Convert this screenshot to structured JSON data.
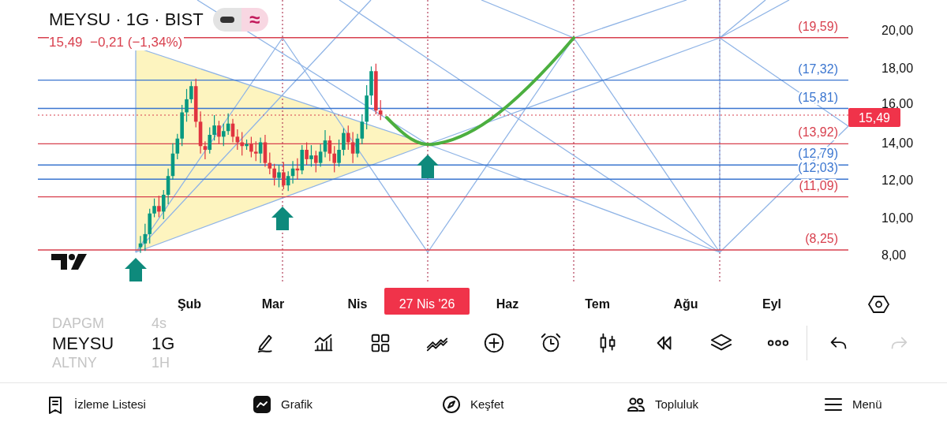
{
  "header": {
    "title": "MEYSU · 1G · BIST",
    "mode_glyph": "≈",
    "quote": "15,49  −0,21 (−1,34%)"
  },
  "levels": [
    {
      "label": "(19,59)",
      "color": "#d8404e"
    },
    {
      "label": "(17,32)",
      "color": "#3b76d0"
    },
    {
      "label": "(15,81)",
      "color": "#3b76d0"
    },
    {
      "label": "(13,92)",
      "color": "#d8404e"
    },
    {
      "label": "(12,79)",
      "color": "#3b76d0"
    },
    {
      "label": "(12,03)",
      "color": "#3b76d0"
    },
    {
      "label": "(11,09)",
      "color": "#d8404e"
    },
    {
      "label": "(8,25)",
      "color": "#d8404e"
    }
  ],
  "y_axis": [
    "20,00",
    "18,00",
    "16,00",
    "14,00",
    "12,00",
    "10,00",
    "8,00"
  ],
  "price_tag": "15,49",
  "x_axis": [
    {
      "label": "Şub",
      "selected": false
    },
    {
      "label": "Mar",
      "selected": false
    },
    {
      "label": "Nis",
      "selected": false
    },
    {
      "label": "27 Nis '26",
      "selected": true
    },
    {
      "label": "Haz",
      "selected": false
    },
    {
      "label": "Tem",
      "selected": false
    },
    {
      "label": "Ağu",
      "selected": false
    },
    {
      "label": "Eyl",
      "selected": false
    }
  ],
  "symbols": [
    {
      "name": "DAPGM",
      "interval": "4s",
      "selected": false
    },
    {
      "name": "MEYSU",
      "interval": "1G",
      "selected": true
    },
    {
      "name": "ALTNY",
      "interval": "1H",
      "selected": false
    }
  ],
  "toolbar": [
    {
      "kind": "pencil",
      "disabled": false
    },
    {
      "kind": "indicators",
      "disabled": false
    },
    {
      "kind": "grid",
      "disabled": false
    },
    {
      "kind": "wave",
      "disabled": false
    },
    {
      "kind": "plus",
      "disabled": false
    },
    {
      "kind": "alarm",
      "disabled": false
    },
    {
      "kind": "candle",
      "disabled": false
    },
    {
      "kind": "rewind",
      "disabled": false
    },
    {
      "kind": "layers",
      "disabled": false
    },
    {
      "kind": "more",
      "disabled": false
    },
    {
      "kind": "undo",
      "disabled": false
    },
    {
      "kind": "redo",
      "disabled": true
    }
  ],
  "nav": [
    {
      "kind": "watchlist",
      "label": "İzleme Listesi",
      "selected": false
    },
    {
      "kind": "chart",
      "label": "Grafik",
      "selected": true
    },
    {
      "kind": "explore",
      "label": "Keşfet",
      "selected": false
    },
    {
      "kind": "community",
      "label": "Topluluk",
      "selected": false
    },
    {
      "kind": "menu",
      "label": "Menü",
      "selected": false
    }
  ]
}
